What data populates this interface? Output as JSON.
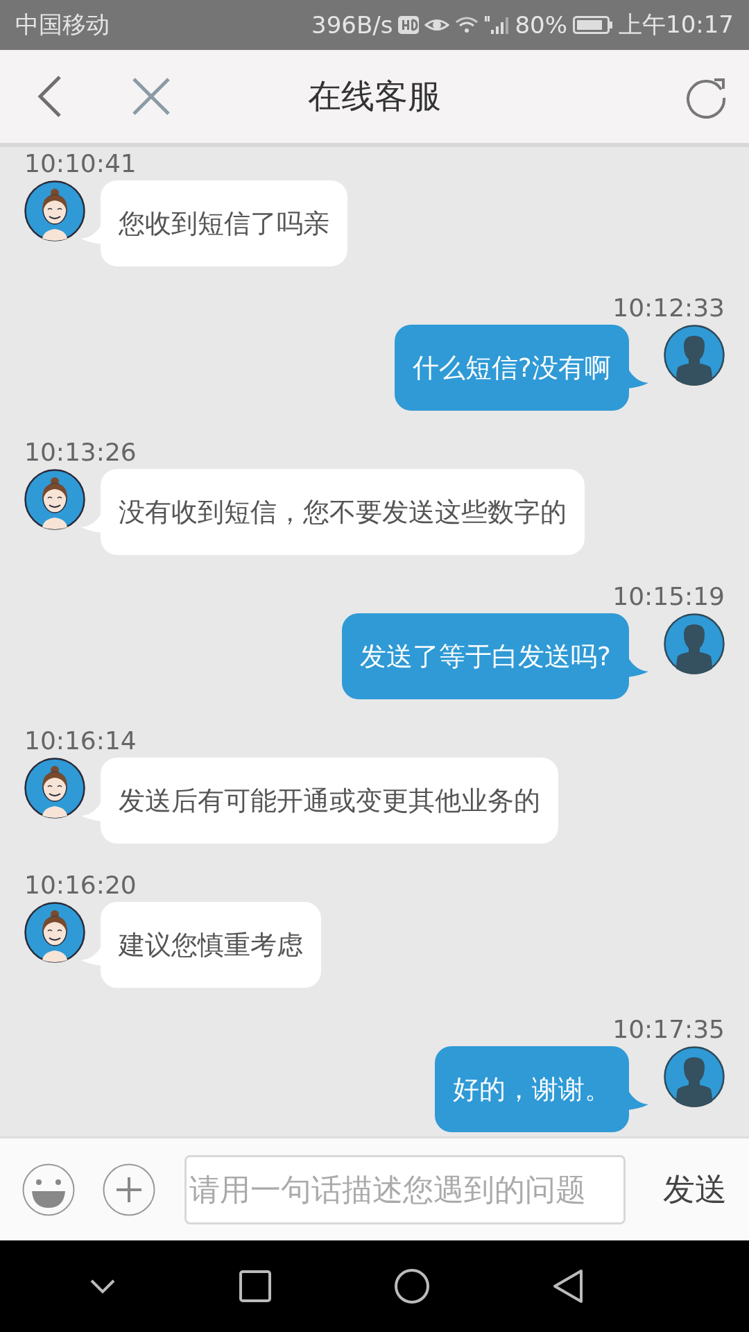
{
  "status_bar": {
    "carrier": "中国移动",
    "speed": "396B/s",
    "battery": "80%",
    "time": "上午10:17"
  },
  "header": {
    "title": "在线客服"
  },
  "messages": [
    {
      "kind": "agent",
      "time": "10:10:41",
      "text": "您收到短信了吗亲"
    },
    {
      "kind": "user",
      "time": "10:12:33",
      "text": "什么短信?没有啊"
    },
    {
      "kind": "agent",
      "time": "10:13:26",
      "text": "没有收到短信，您不要发送这些数字的"
    },
    {
      "kind": "user",
      "time": "10:15:19",
      "text": "发送了等于白发送吗?"
    },
    {
      "kind": "agent",
      "time": "10:16:14",
      "text": "发送后有可能开通或变更其他业务的"
    },
    {
      "kind": "agent",
      "time": "10:16:20",
      "text": "建议您慎重考虑"
    },
    {
      "kind": "user",
      "time": "10:17:35",
      "text": "好的，谢谢。"
    }
  ],
  "input_bar": {
    "placeholder": "请用一句话描述您遇到的问题",
    "send": "发送"
  }
}
